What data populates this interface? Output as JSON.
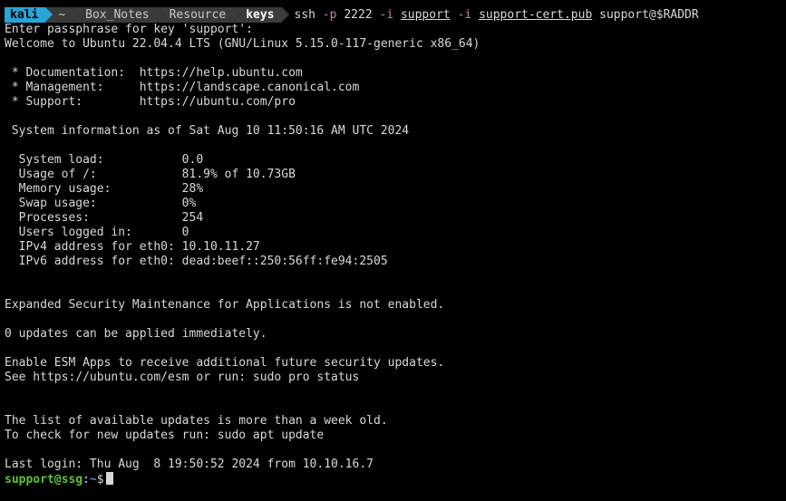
{
  "prompt": {
    "host": "kali",
    "path_segments": [
      "~",
      "Box_Notes",
      "Resource",
      "keys"
    ]
  },
  "command": {
    "exe": "ssh",
    "flag_p": "-p",
    "port": "2222",
    "flag_i1": "-i",
    "key1": "support",
    "flag_i2": "-i",
    "key2": "support-cert.pub",
    "target": "support@$RADDR"
  },
  "output_lines": [
    "Enter passphrase for key 'support':",
    "Welcome to Ubuntu 22.04.4 LTS (GNU/Linux 5.15.0-117-generic x86_64)",
    "",
    " * Documentation:  https://help.ubuntu.com",
    " * Management:     https://landscape.canonical.com",
    " * Support:        https://ubuntu.com/pro",
    "",
    " System information as of Sat Aug 10 11:50:16 AM UTC 2024",
    "",
    "  System load:           0.0",
    "  Usage of /:            81.9% of 10.73GB",
    "  Memory usage:          28%",
    "  Swap usage:            0%",
    "  Processes:             254",
    "  Users logged in:       0",
    "  IPv4 address for eth0: 10.10.11.27",
    "  IPv6 address for eth0: dead:beef::250:56ff:fe94:2505",
    "",
    "",
    "Expanded Security Maintenance for Applications is not enabled.",
    "",
    "0 updates can be applied immediately.",
    "",
    "Enable ESM Apps to receive additional future security updates.",
    "See https://ubuntu.com/esm or run: sudo pro status",
    "",
    "",
    "The list of available updates is more than a week old.",
    "To check for new updates run: sudo apt update",
    "",
    "Last login: Thu Aug  8 19:50:52 2024 from 10.10.16.7"
  ],
  "remote_prompt": {
    "userhost": "support@ssg",
    "colon": ":",
    "path": "~",
    "dollar": "$"
  }
}
